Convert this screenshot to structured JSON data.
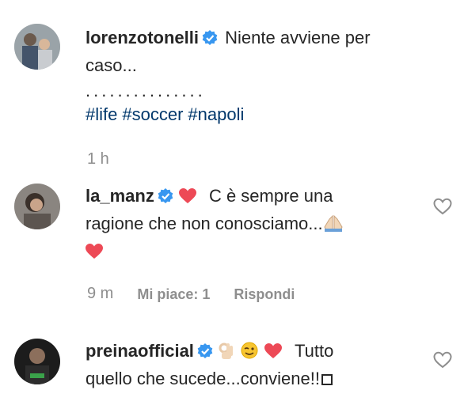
{
  "comments": [
    {
      "username": "lorenzotonelli",
      "text_line1": "Niente avviene per",
      "text_line2": "caso...",
      "dots": "...............",
      "hashtags": [
        "#life",
        "#soccer",
        "#napoli"
      ],
      "time": "1 h"
    },
    {
      "username": "la_manz",
      "text_line1": "C è sempre una",
      "text_line2": "ragione che non conosciamo...",
      "time": "9 m",
      "likes": "Mi piace: 1",
      "reply": "Rispondi"
    },
    {
      "username": "preinaofficial",
      "text_line1": "Tutto",
      "text_line2": "quello che sucede...conviene!!"
    }
  ],
  "icons": {
    "verified": "verified-badge-icon",
    "like": "heart-outline-icon",
    "red_heart": "red-heart-emoji",
    "pray": "folded-hands-emoji",
    "ok_hand": "ok-hand-emoji",
    "wink": "winking-face-emoji"
  },
  "colors": {
    "verified_blue": "#3897f0",
    "hashtag": "#00376b",
    "meta_gray": "#8e8e8e",
    "heart_red": "#ed4956"
  }
}
